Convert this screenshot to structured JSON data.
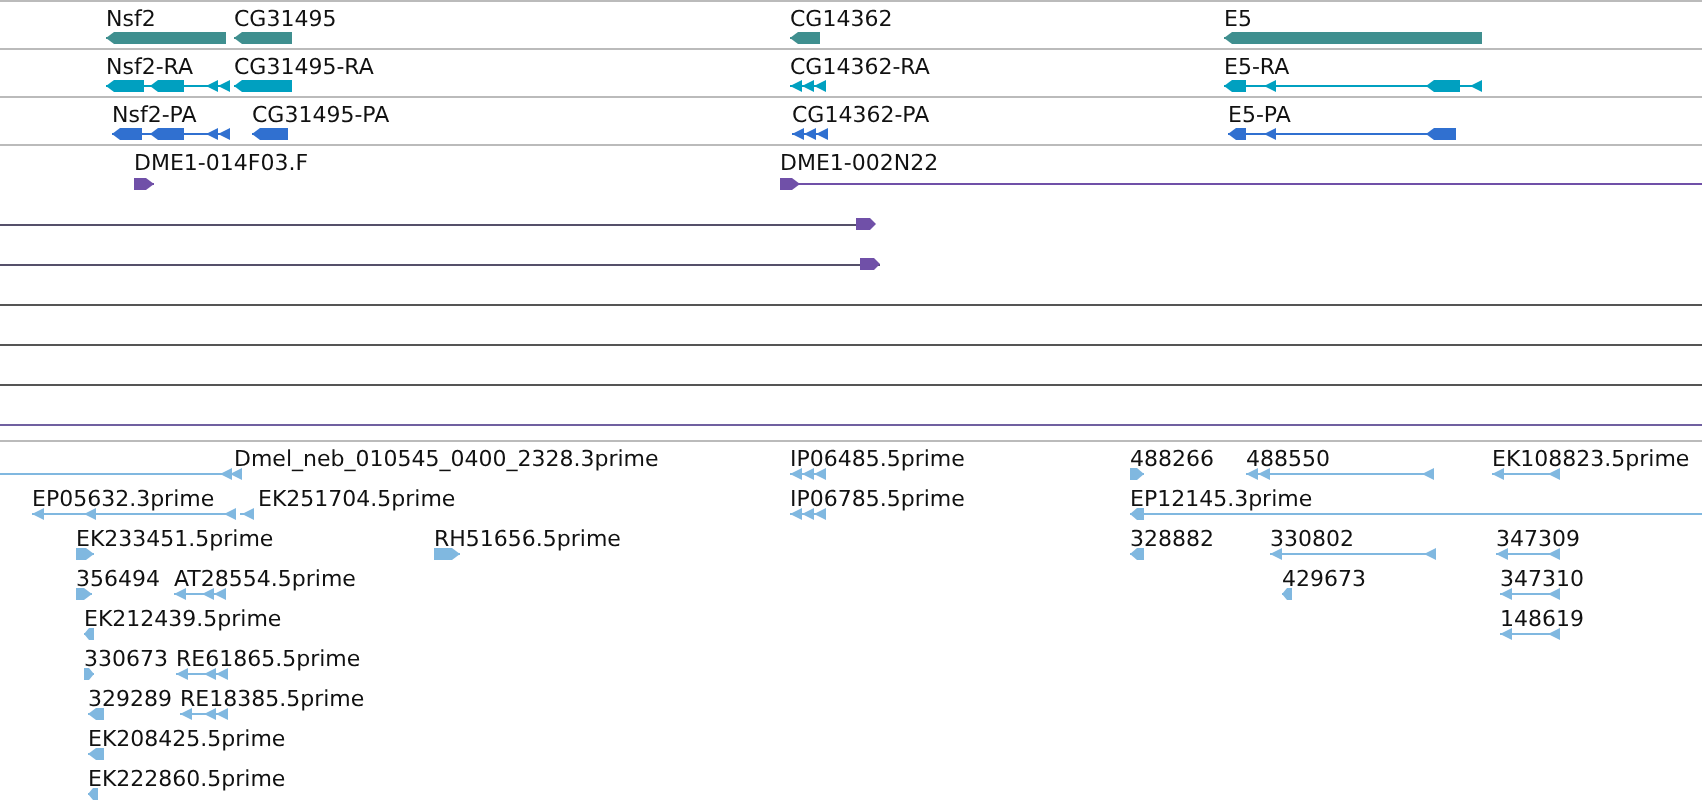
{
  "tracks": [
    {
      "kind": "gene",
      "features": [
        {
          "label": "Nsf2",
          "reverse_strand": true
        },
        {
          "label": "CG31495",
          "reverse_strand": true
        },
        {
          "label": "CG14362",
          "reverse_strand": true
        },
        {
          "label": "E5",
          "reverse_strand": true
        }
      ]
    },
    {
      "kind": "transcript",
      "features": [
        {
          "label": "Nsf2-RA",
          "reverse_strand": true
        },
        {
          "label": "CG31495-RA",
          "reverse_strand": true
        },
        {
          "label": "CG14362-RA",
          "reverse_strand": true
        },
        {
          "label": "E5-RA",
          "reverse_strand": true
        }
      ]
    },
    {
      "kind": "translation",
      "features": [
        {
          "label": "Nsf2-PA",
          "reverse_strand": true
        },
        {
          "label": "CG31495-PA",
          "reverse_strand": true
        },
        {
          "label": "CG14362-PA",
          "reverse_strand": true
        },
        {
          "label": "E5-PA",
          "reverse_strand": true
        }
      ]
    },
    {
      "kind": "clone",
      "features": [
        {
          "label": "DME1-014F03.F",
          "reverse_strand": false
        },
        {
          "label": "DME1-002N22",
          "reverse_strand": false
        }
      ]
    },
    {
      "kind": "est",
      "features": [
        {
          "label": "Dmel_neb_010545_0400_2328.3prime",
          "reverse_strand": true
        },
        {
          "label": "IP06485.5prime",
          "reverse_strand": true
        },
        {
          "label": "488266",
          "reverse_strand": false
        },
        {
          "label": "488550",
          "reverse_strand": true
        },
        {
          "label": "EK108823.5prime",
          "reverse_strand": true
        },
        {
          "label": "EP05632.3prime",
          "reverse_strand": true
        },
        {
          "label": "EK251704.5prime",
          "reverse_strand": true
        },
        {
          "label": "IP06785.5prime",
          "reverse_strand": true
        },
        {
          "label": "EP12145.3prime",
          "reverse_strand": true
        },
        {
          "label": "EK233451.5prime",
          "reverse_strand": false
        },
        {
          "label": "RH51656.5prime",
          "reverse_strand": false
        },
        {
          "label": "328882",
          "reverse_strand": true
        },
        {
          "label": "330802",
          "reverse_strand": true
        },
        {
          "label": "347309",
          "reverse_strand": true
        },
        {
          "label": "356494",
          "reverse_strand": false
        },
        {
          "label": "AT28554.5prime",
          "reverse_strand": true
        },
        {
          "label": "429673",
          "reverse_strand": true
        },
        {
          "label": "347310",
          "reverse_strand": true
        },
        {
          "label": "EK212439.5prime",
          "reverse_strand": true
        },
        {
          "label": "148619",
          "reverse_strand": true
        },
        {
          "label": "330673",
          "reverse_strand": false
        },
        {
          "label": "RE61865.5prime",
          "reverse_strand": true
        },
        {
          "label": "329289",
          "reverse_strand": true
        },
        {
          "label": "RE18385.5prime",
          "reverse_strand": true
        },
        {
          "label": "EK208425.5prime",
          "reverse_strand": true
        },
        {
          "label": "EK222860.5prime",
          "reverse_strand": true
        }
      ]
    }
  ]
}
